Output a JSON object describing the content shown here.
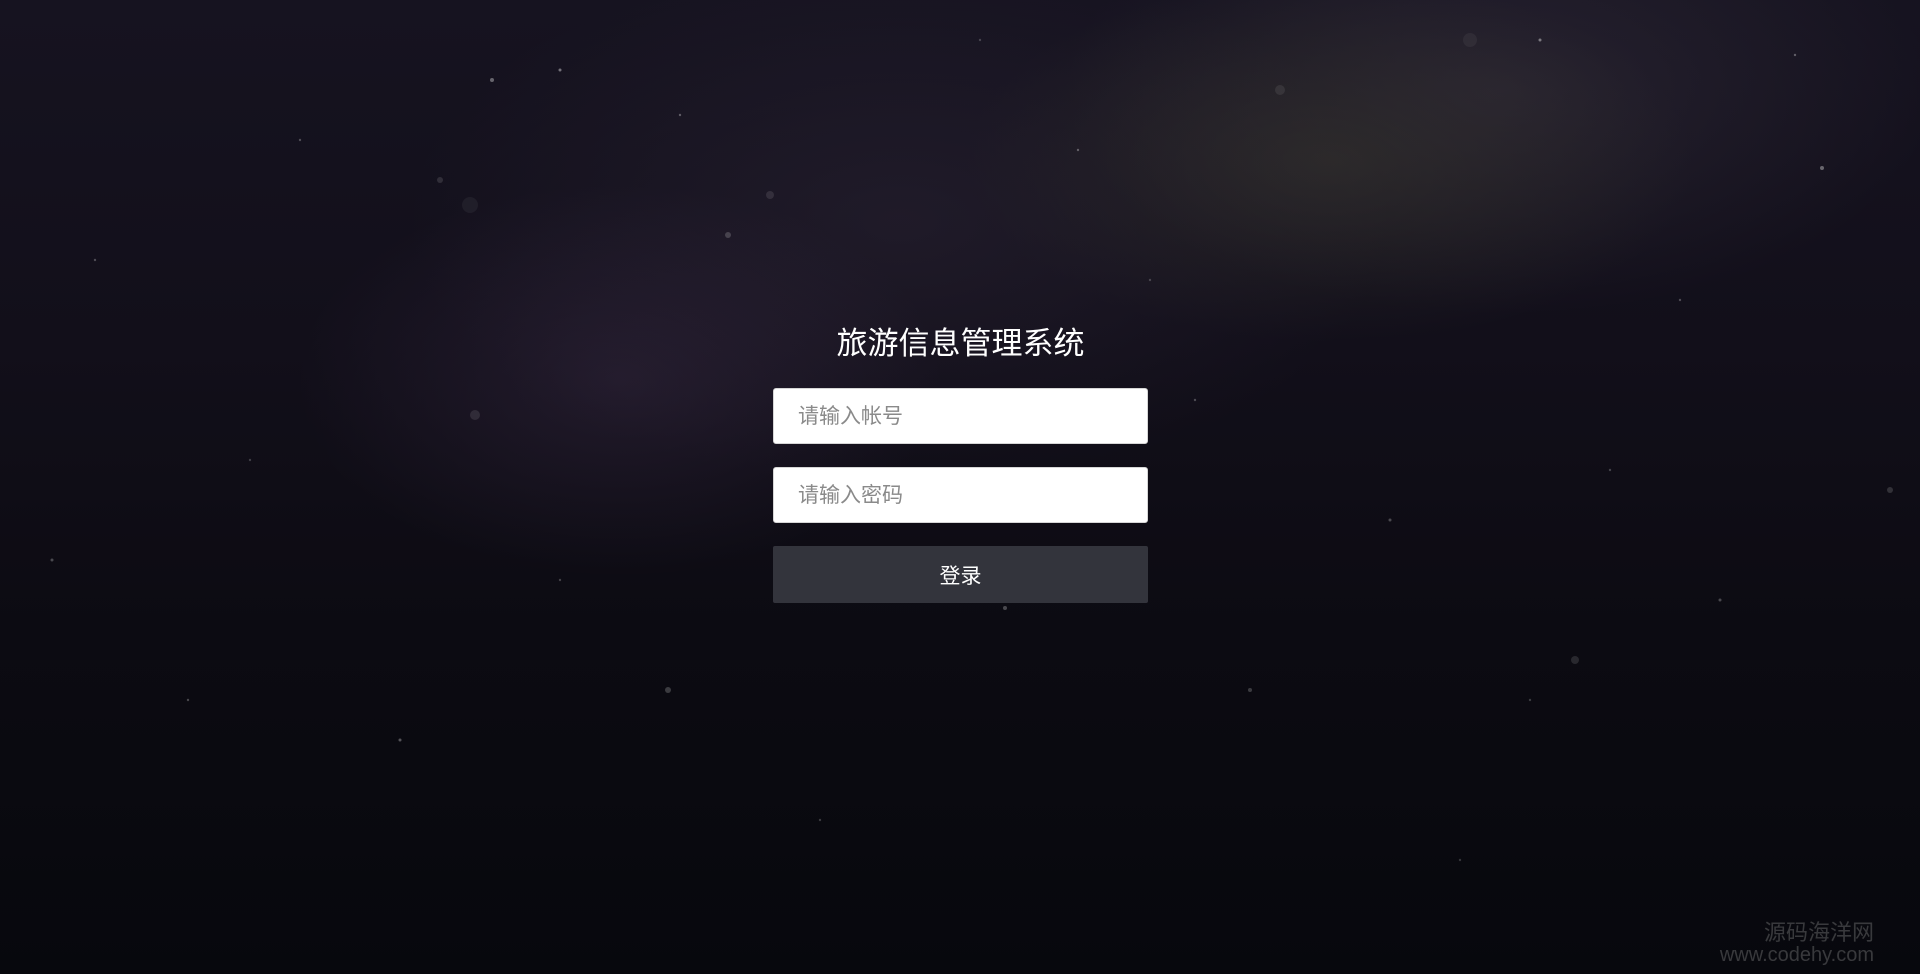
{
  "login": {
    "title": "旅游信息管理系统",
    "account_placeholder": "请输入帐号",
    "password_placeholder": "请输入密码",
    "submit_label": "登录"
  },
  "watermark": {
    "text": "源码海洋网",
    "url": "www.codehy.com"
  },
  "colors": {
    "background": "#0c0b12",
    "button": "#33343c",
    "title_text": "#ffffff",
    "input_background": "#ffffff"
  }
}
